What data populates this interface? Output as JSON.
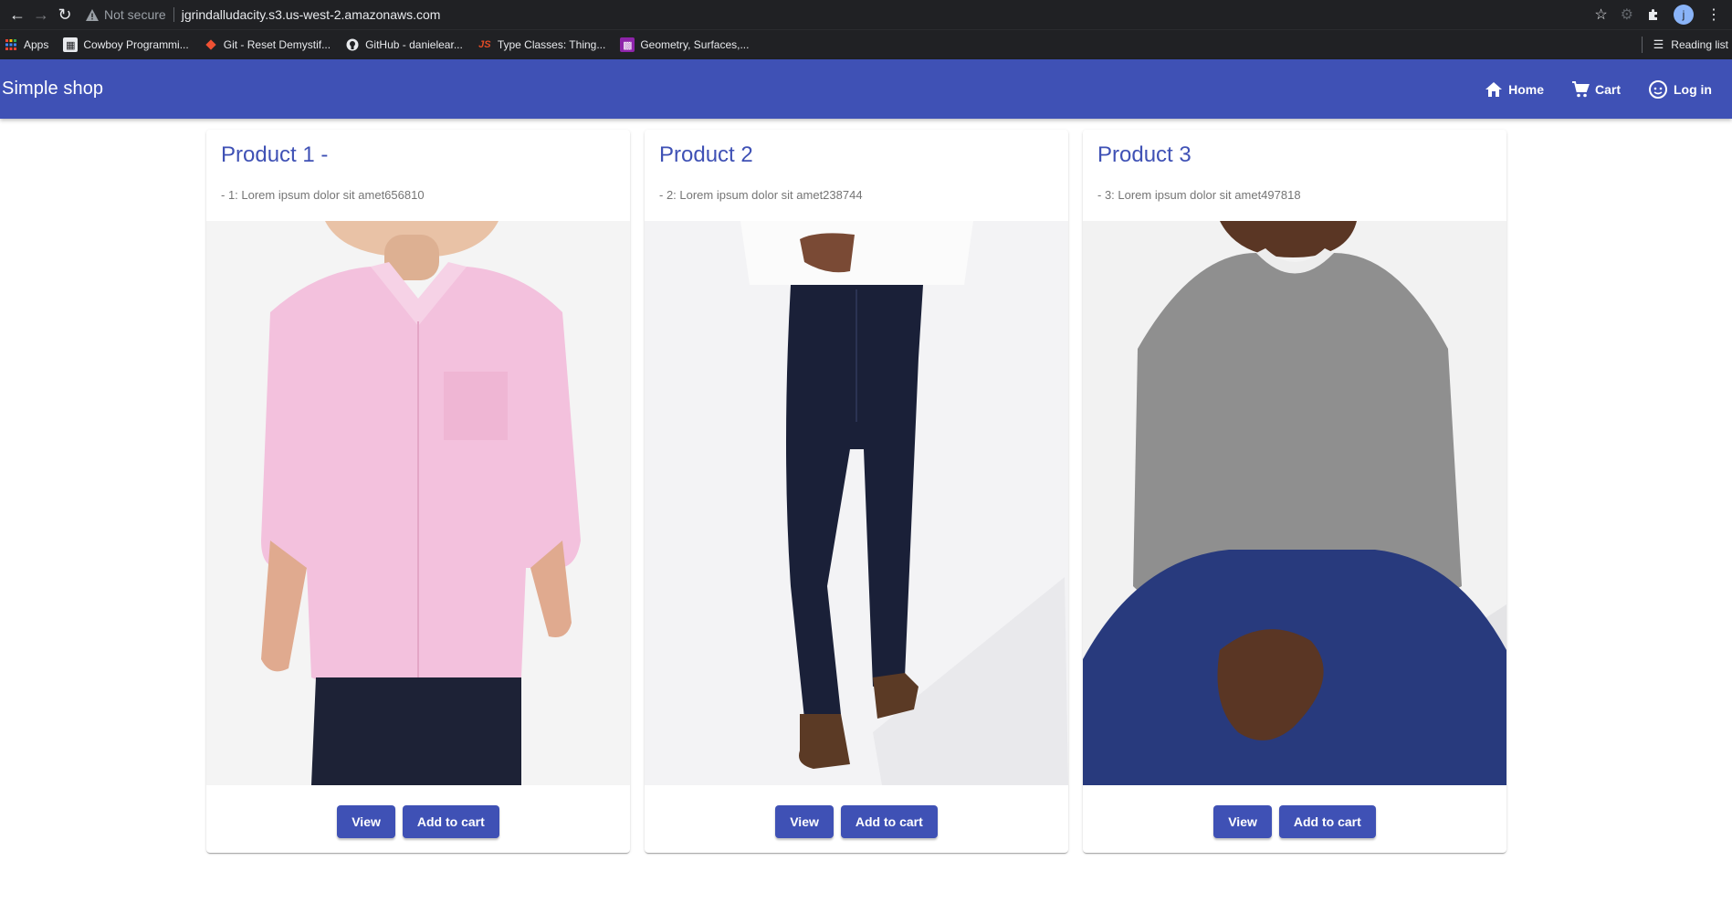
{
  "browser": {
    "security_label": "Not secure",
    "url": "jgrindalludacity.s3.us-west-2.amazonaws.com",
    "avatar_letter": "j",
    "bookmarks": [
      {
        "label": "Apps",
        "icon": "apps-grid-icon"
      },
      {
        "label": "Cowboy Programmi...",
        "icon": "bookmark-icon"
      },
      {
        "label": "Git - Reset Demystif...",
        "icon": "git-icon"
      },
      {
        "label": "GitHub - danielear...",
        "icon": "github-icon"
      },
      {
        "label": "Type Classes: Thing...",
        "icon": "js-icon"
      },
      {
        "label": "Geometry, Surfaces,...",
        "icon": "bookmark-icon"
      }
    ],
    "reading_list": "Reading list"
  },
  "app": {
    "brand": "Simple shop",
    "nav": [
      {
        "label": "Home",
        "icon": "home-icon"
      },
      {
        "label": "Cart",
        "icon": "cart-icon"
      },
      {
        "label": "Log in",
        "icon": "login-icon"
      }
    ],
    "accent": "#3f51b5"
  },
  "products": [
    {
      "title": "Product 1 -",
      "subtitle": "- 1: Lorem ipsum dolor sit amet656810",
      "image": "pink-shirt-image",
      "view_label": "View",
      "cart_label": "Add to cart"
    },
    {
      "title": "Product 2",
      "subtitle": "- 2: Lorem ipsum dolor sit amet238744",
      "image": "dark-jeans-image",
      "view_label": "View",
      "cart_label": "Add to cart"
    },
    {
      "title": "Product 3",
      "subtitle": "- 3: Lorem ipsum dolor sit amet497818",
      "image": "grey-sweater-image",
      "view_label": "View",
      "cart_label": "Add to cart"
    }
  ]
}
